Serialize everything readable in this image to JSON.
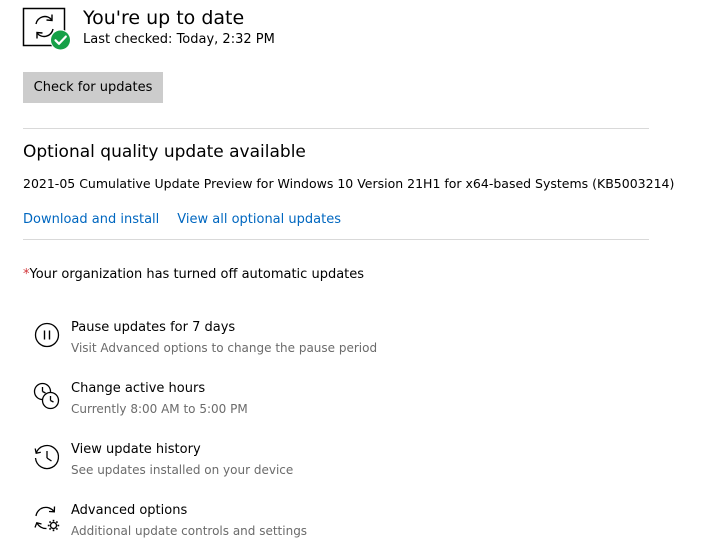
{
  "status": {
    "title": "You're up to date",
    "last_checked": "Last checked: Today, 2:32 PM",
    "icon": "sync-check-icon",
    "check_color": "#15a047"
  },
  "check_button": {
    "label": "Check for updates"
  },
  "optional_update": {
    "title": "Optional quality update available",
    "description": "2021-05 Cumulative Update Preview for Windows 10 Version 21H1 for x64-based Systems (KB5003214)",
    "download_link": "Download and install",
    "view_all_link": "View all optional updates"
  },
  "org_note": {
    "asterisk": "*",
    "text": "Your organization has turned off automatic updates"
  },
  "options": [
    {
      "icon": "pause-icon",
      "title": "Pause updates for 7 days",
      "subtitle": "Visit Advanced options to change the pause period"
    },
    {
      "icon": "active-hours-icon",
      "title": "Change active hours",
      "subtitle": "Currently 8:00 AM to 5:00 PM"
    },
    {
      "icon": "history-icon",
      "title": "View update history",
      "subtitle": "See updates installed on your device"
    },
    {
      "icon": "advanced-options-icon",
      "title": "Advanced options",
      "subtitle": "Additional update controls and settings"
    }
  ],
  "colors": {
    "link": "#0067c0",
    "secondary_text": "#6b6b6b",
    "button_bg": "#cccccc",
    "asterisk": "#d13438",
    "divider": "#d9d9d9"
  }
}
